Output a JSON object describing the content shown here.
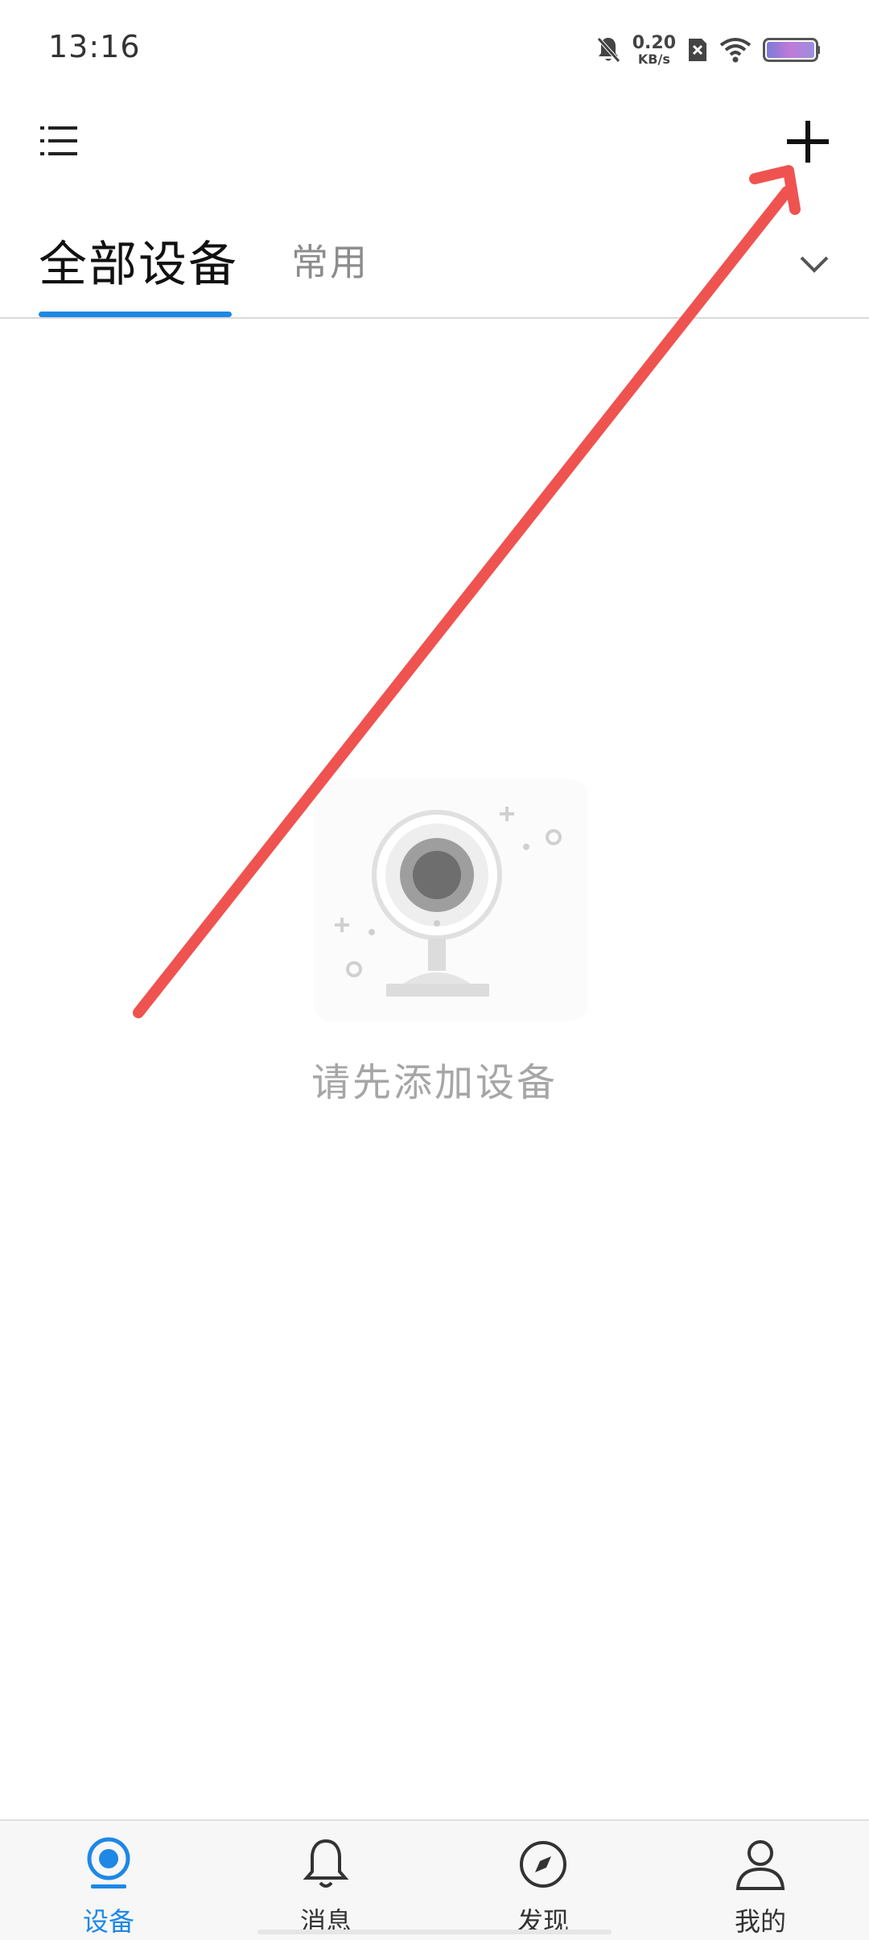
{
  "status_bar": {
    "time": "13:16",
    "net_speed_value": "0.20",
    "net_speed_unit": "KB/s",
    "icons": [
      "mute-bell-icon",
      "sim-x-icon",
      "wifi-icon",
      "battery-icon"
    ]
  },
  "header": {
    "menu_icon": "list-menu-icon",
    "add_icon": "plus-icon"
  },
  "tabs": {
    "all_devices": "全部设备",
    "common": "常用",
    "dropdown_icon": "chevron-down-icon",
    "active_color": "#1e88e5"
  },
  "empty_state": {
    "illustration_icon": "webcam-icon",
    "message": "请先添加设备"
  },
  "bottom_nav": {
    "items": [
      {
        "label": "设备",
        "icon": "device-camera-icon",
        "active": true
      },
      {
        "label": "消息",
        "icon": "bell-icon",
        "active": false
      },
      {
        "label": "发现",
        "icon": "compass-icon",
        "active": false
      },
      {
        "label": "我的",
        "icon": "person-icon",
        "active": false
      }
    ]
  },
  "annotation": {
    "color": "#ef5350"
  }
}
